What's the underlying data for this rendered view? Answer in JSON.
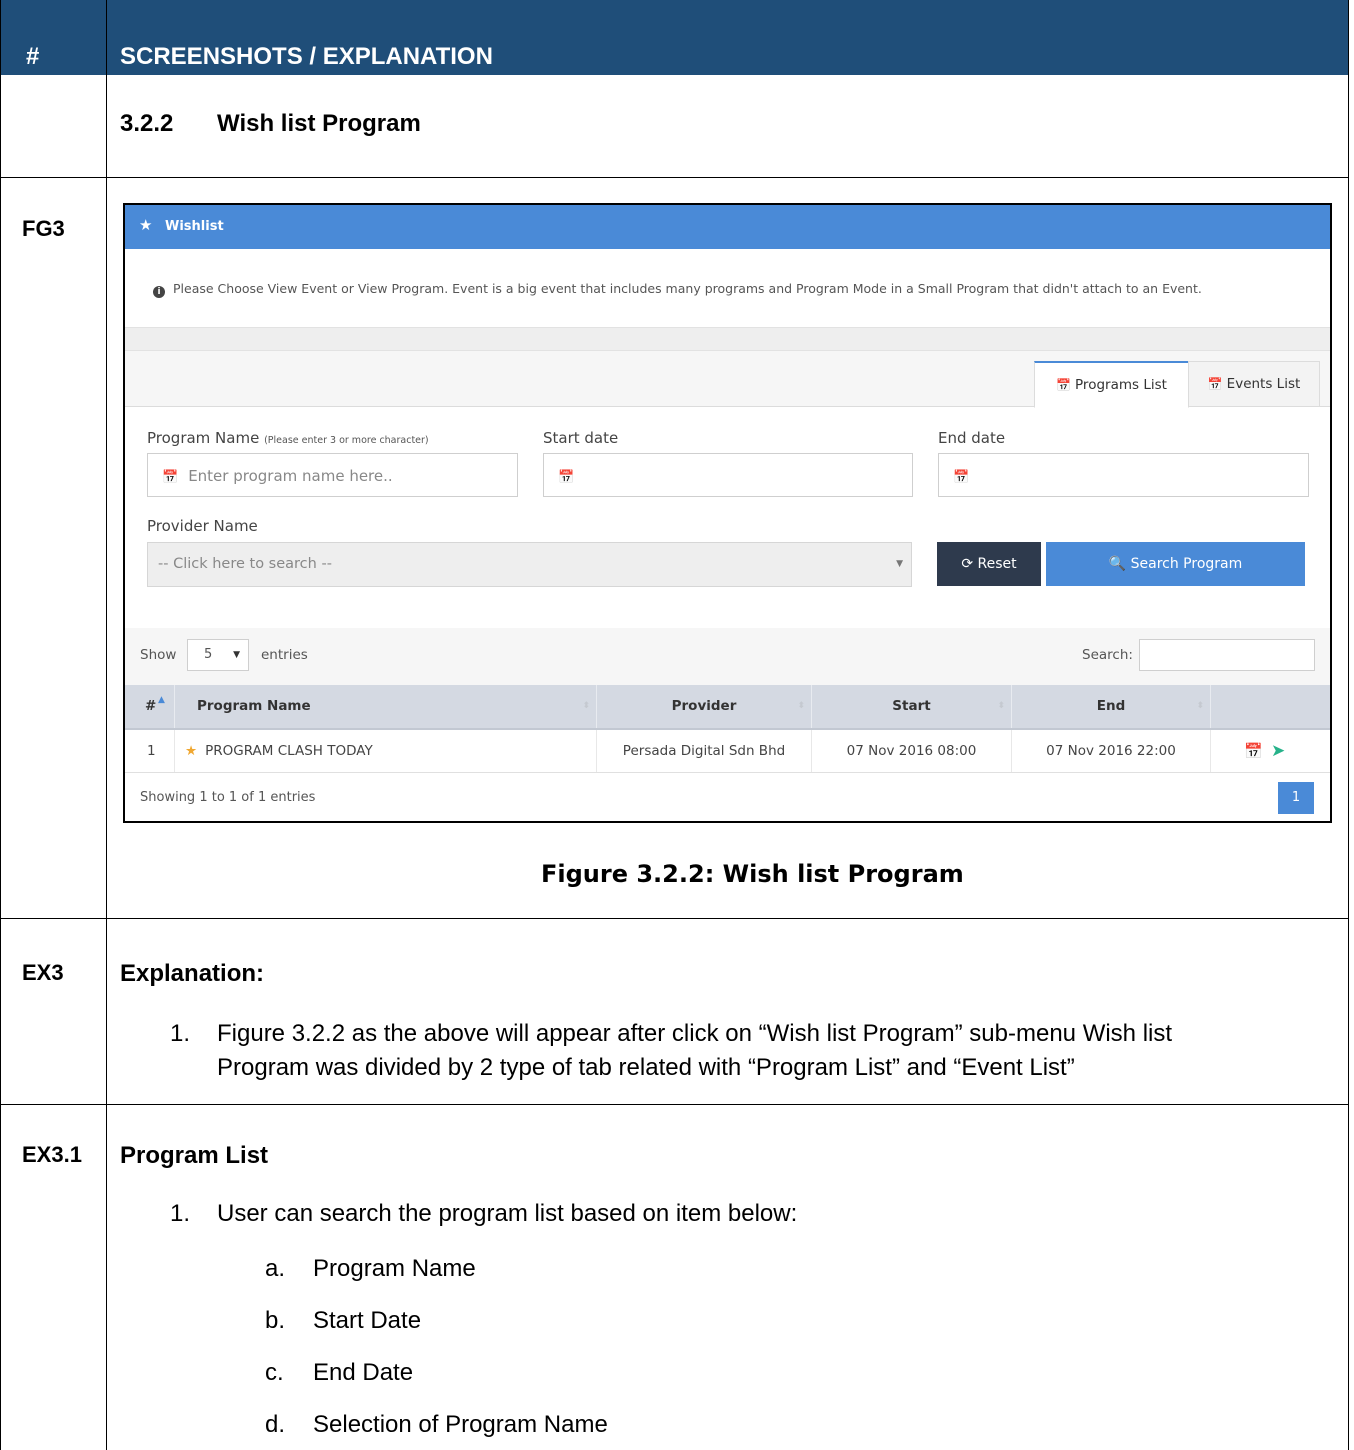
{
  "table_header": {
    "hash": "#",
    "title": "SCREENSHOTS / EXPLANATION"
  },
  "section": {
    "number": "3.2.2",
    "title": "Wish list Program"
  },
  "rows": {
    "fg3": "FG3",
    "ex3": "EX3",
    "ex31": "EX3.1"
  },
  "screenshot": {
    "panel_title": "Wishlist",
    "info_text": "Please Choose View Event or View Program. Event is a big event that includes many programs and Program Mode in a Small Program that didn't attach to an Event.",
    "tabs": [
      "Programs List",
      "Events List"
    ],
    "form": {
      "program_name_label": "Program Name",
      "program_name_hint": "(Please enter 3 or more character)",
      "program_name_placeholder": "Enter program name here..",
      "start_date_label": "Start date",
      "end_date_label": "End date",
      "provider_label": "Provider Name",
      "provider_placeholder": "-- Click here to search --",
      "reset_label": "Reset",
      "search_label": "Search Program"
    },
    "table_controls": {
      "show": "Show",
      "entries_value": "5",
      "entries": "entries",
      "search": "Search:"
    },
    "columns": [
      "#",
      "Program Name",
      "Provider",
      "Start",
      "End"
    ],
    "rows": [
      {
        "num": "1",
        "name": "PROGRAM CLASH TODAY",
        "provider": "Persada Digital Sdn Bhd",
        "start": "07 Nov 2016 08:00",
        "end": "07 Nov 2016 22:00"
      }
    ],
    "footer": "Showing 1 to 1 of 1 entries",
    "page": "1",
    "colors": {
      "header": "#4a8ad7",
      "reset_button": "#2e3a4d",
      "star": "#f0a832",
      "send_icon": "#26b28a"
    }
  },
  "caption": "Figure 3.2.2: Wish list Program",
  "explanation": {
    "title": "Explanation:",
    "item1_num": "1.",
    "item1_line1": "Figure 3.2.2 as the above will appear after click on “Wish list Program” sub-menu Wish list",
    "item1_line2": "Program was divided by 2 type of tab related with “Program List” and “Event List”"
  },
  "program_list": {
    "title": "Program List",
    "item1_num": "1.",
    "item1": "User can search the program list based on item below:",
    "subitems": [
      {
        "letter": "a.",
        "text": "Program Name"
      },
      {
        "letter": "b.",
        "text": "Start Date"
      },
      {
        "letter": "c.",
        "text": "End Date"
      },
      {
        "letter": "d.",
        "text": "Selection of Program Name"
      }
    ]
  },
  "header_color": "#1f4e79"
}
